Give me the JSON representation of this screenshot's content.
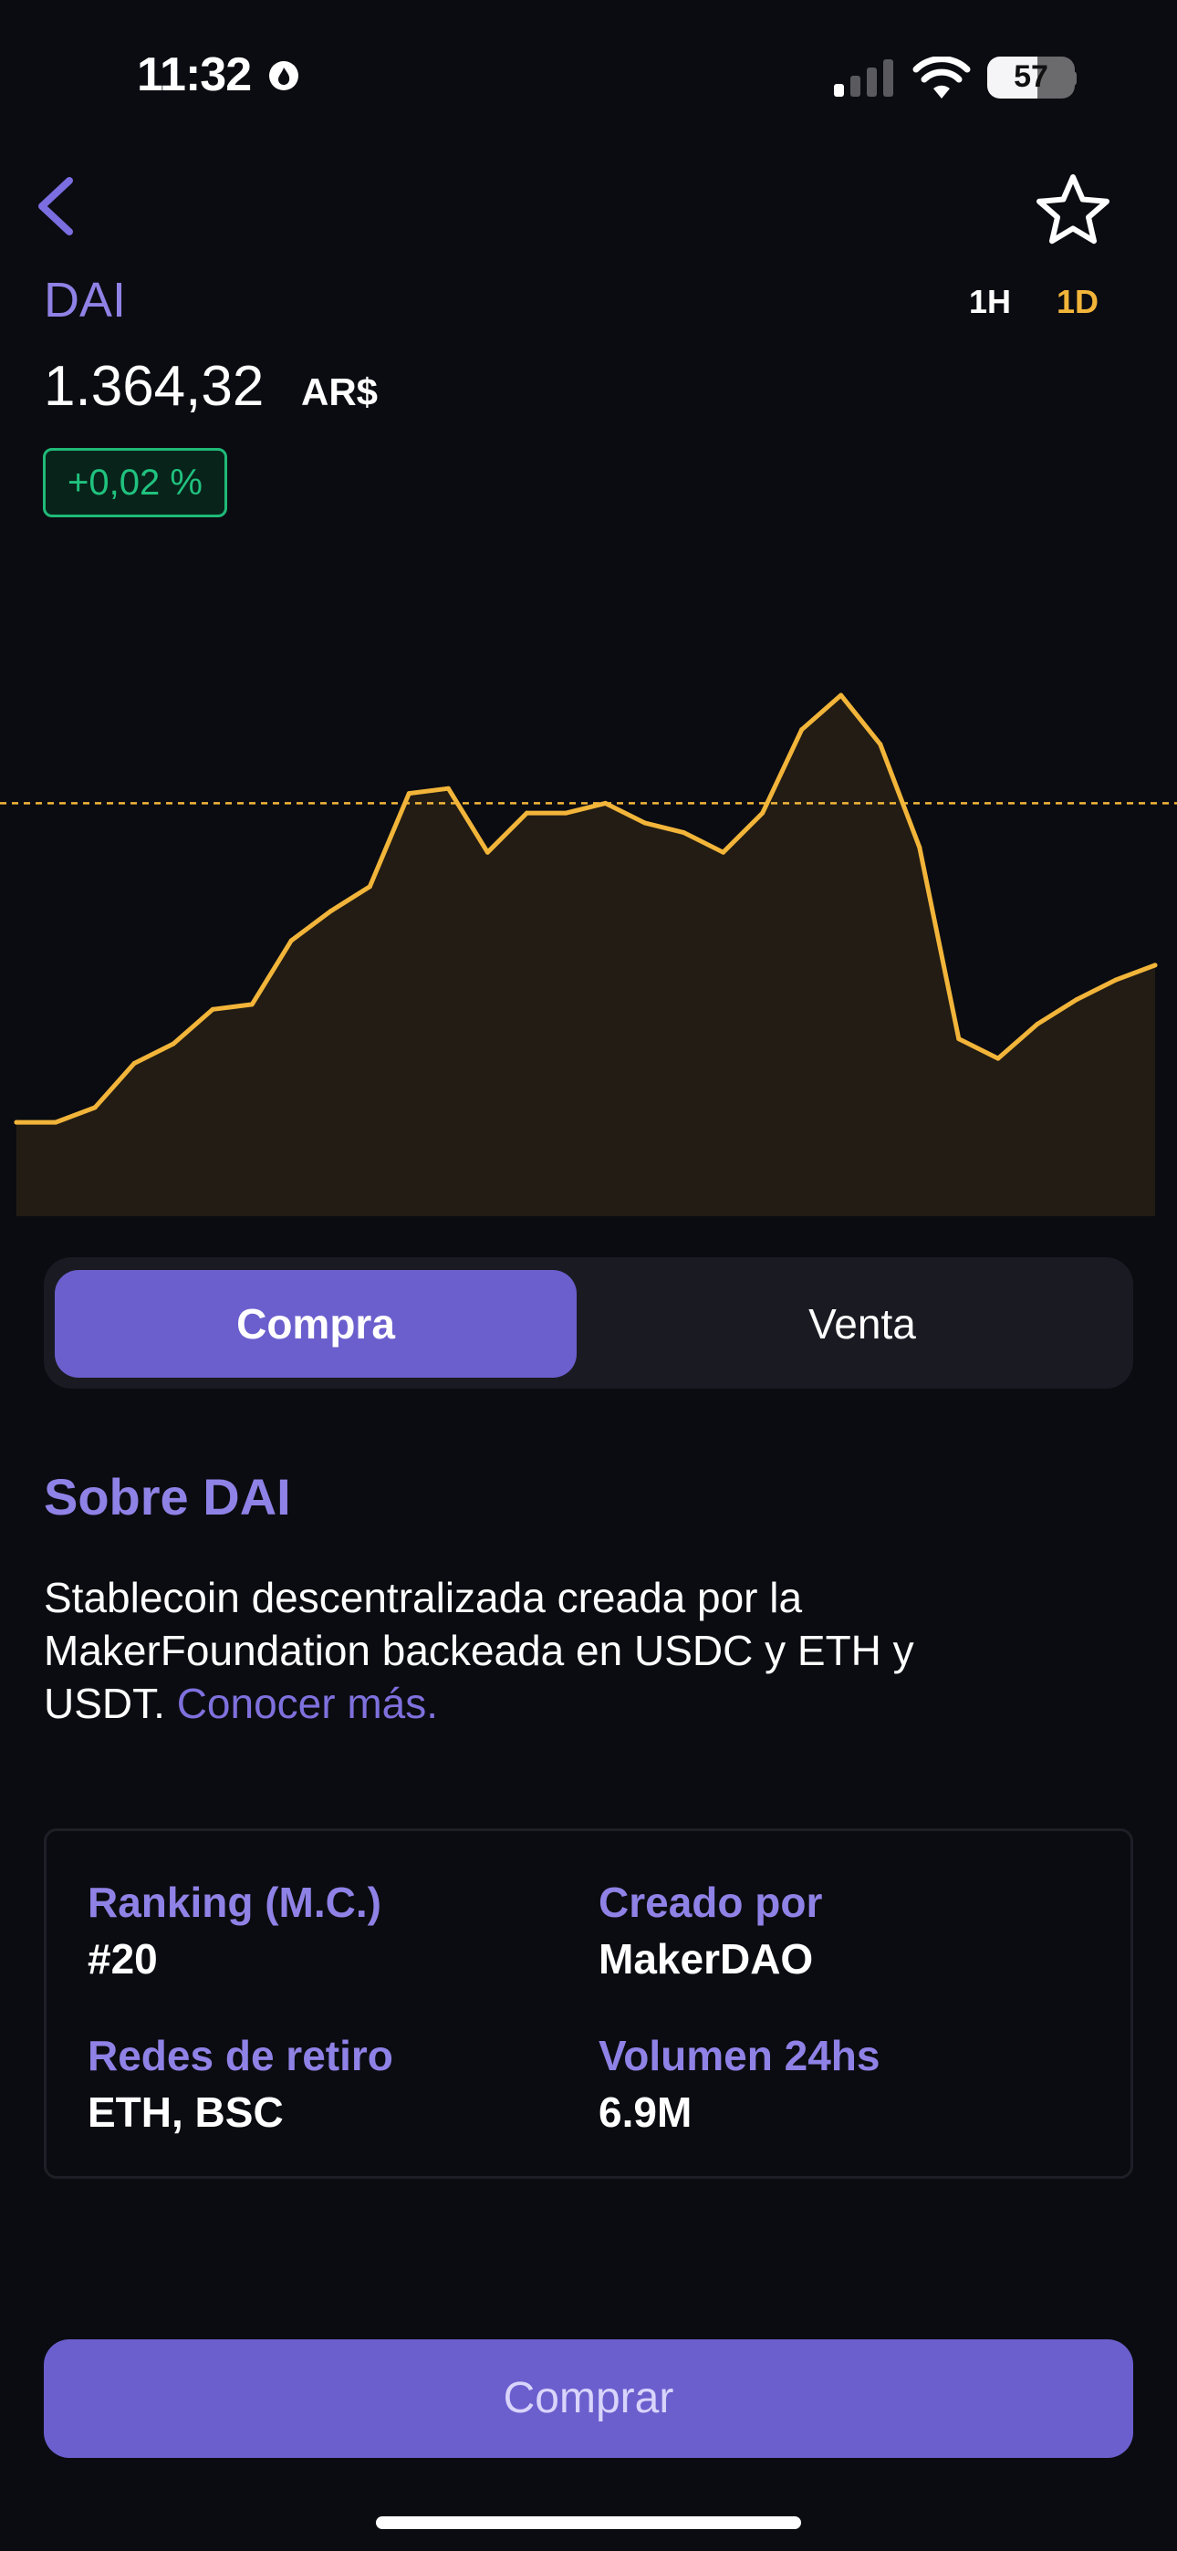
{
  "status_bar": {
    "time": "11:32",
    "battery": "57"
  },
  "header": {
    "coin": "DAI",
    "timeframes": [
      "1H",
      "1D"
    ],
    "selected_timeframe": "1D",
    "price": "1.364,32",
    "currency": "AR$",
    "change": "+0,02 %"
  },
  "chart_data": {
    "type": "area",
    "title": "",
    "xlabel": "",
    "ylabel": "",
    "color": "#f2b53a",
    "reference_line": 78,
    "ylim": [
      0,
      100
    ],
    "x": [
      0,
      1,
      2,
      3,
      4,
      5,
      6,
      7,
      8,
      9,
      10,
      11,
      12,
      13,
      14,
      15,
      16,
      17,
      18,
      19,
      20,
      21,
      22,
      23,
      24,
      25,
      26,
      27,
      28,
      29
    ],
    "values": [
      13,
      13,
      16,
      25,
      29,
      36,
      37,
      50,
      56,
      61,
      80,
      81,
      68,
      76,
      76,
      78,
      74,
      72,
      68,
      76,
      93,
      100,
      90,
      69,
      30,
      26,
      33,
      38,
      42,
      45
    ]
  },
  "segment": {
    "buy_label": "Compra",
    "sell_label": "Venta",
    "selected": "Compra"
  },
  "about": {
    "title": "Sobre DAI",
    "line1": "Stablecoin descentralizada creada por la",
    "line2": "MakerFoundation backeada en USDC y ETH y",
    "line3": "USDT. ",
    "link": "Conocer más."
  },
  "info": {
    "ranking_label": "Ranking (M.C.)",
    "ranking_value": "#20",
    "created_label": "Creado por",
    "created_value": "MakerDAO",
    "networks_label": "Redes de retiro",
    "networks_value": "ETH, BSC",
    "volume_label": "Volumen 24hs",
    "volume_value": "6.9M"
  },
  "cta": {
    "buy_button": "Comprar"
  },
  "colors": {
    "accent": "#6b5fce",
    "chart_line": "#f2b53a",
    "positive": "#20c27f",
    "background": "#0b0c11"
  }
}
